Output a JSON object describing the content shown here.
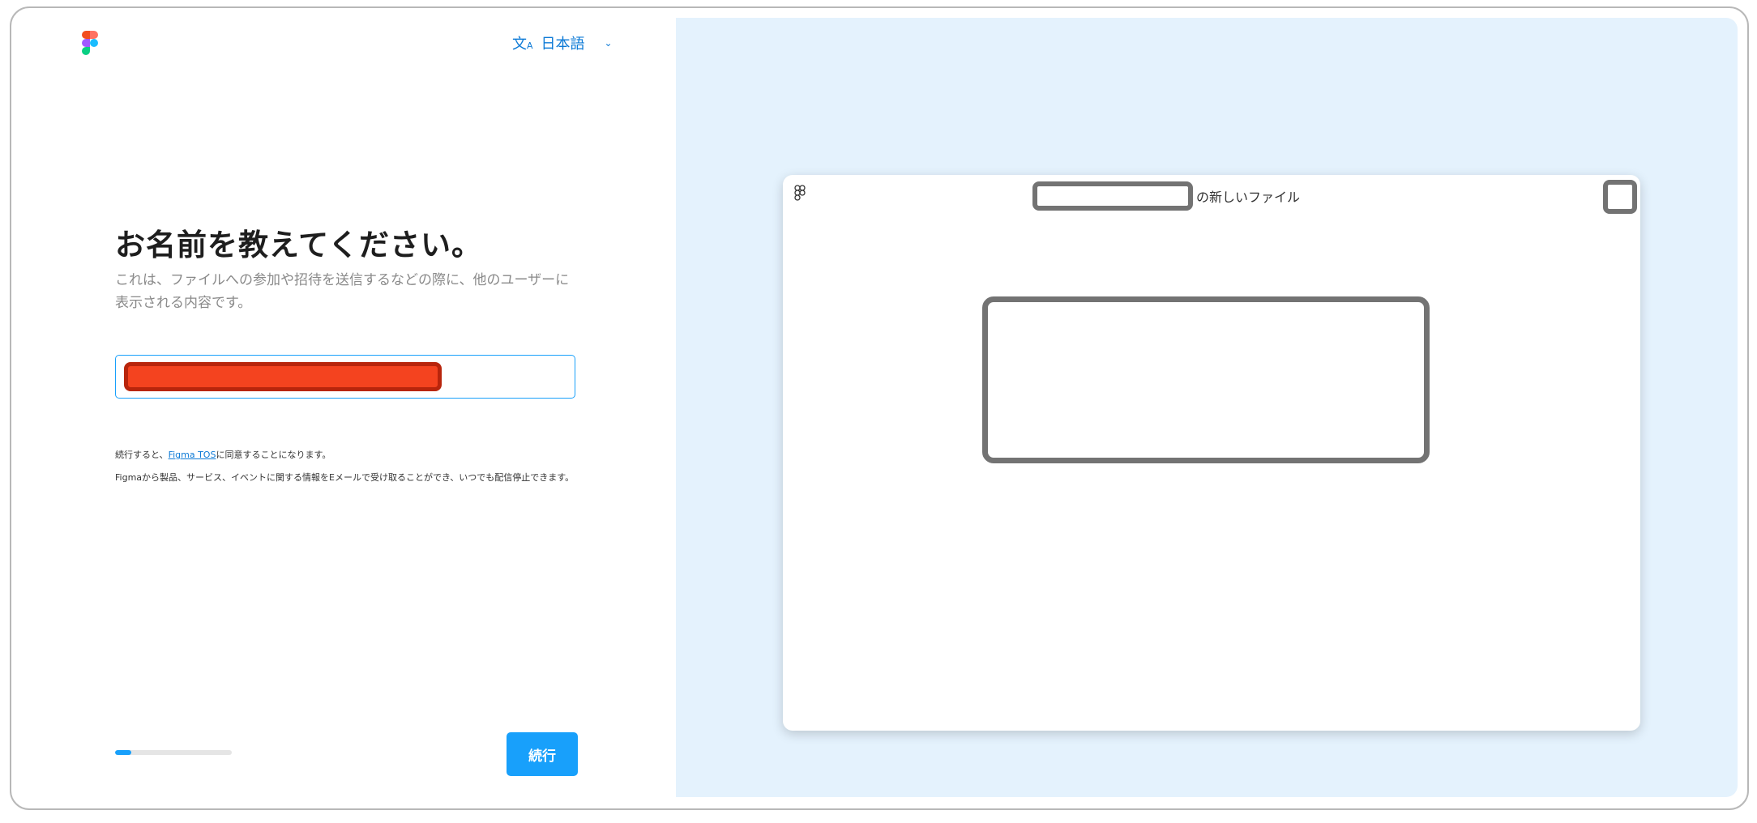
{
  "header": {
    "language_icon": "translate-icon",
    "language_label": "日本語",
    "language_chevron": "⌄"
  },
  "main": {
    "title": "お名前を教えてください。",
    "subtitle": "これは、ファイルへの参加や招待を送信するなどの際に、他のユーザーに表示される内容です。",
    "name_input": {
      "value": "",
      "placeholder": ""
    },
    "legal": {
      "line1_prefix": "続行すると、",
      "line1_link": "Figma TOS",
      "line1_suffix": "に同意することになります。",
      "line2": "Figmaから製品、サービス、イベントに関する情報をEメールで受け取ることができ、いつでも配信停止できます。"
    },
    "progress_percent": 14,
    "continue_label": "続行"
  },
  "preview": {
    "file_title_suffix": "の新しいファイル"
  },
  "colors": {
    "accent": "#18a0fb",
    "link": "#0d7ad6",
    "preview_bg": "#e4f2fd",
    "redaction_red": "#f4431f",
    "redaction_gray": "#737373"
  }
}
